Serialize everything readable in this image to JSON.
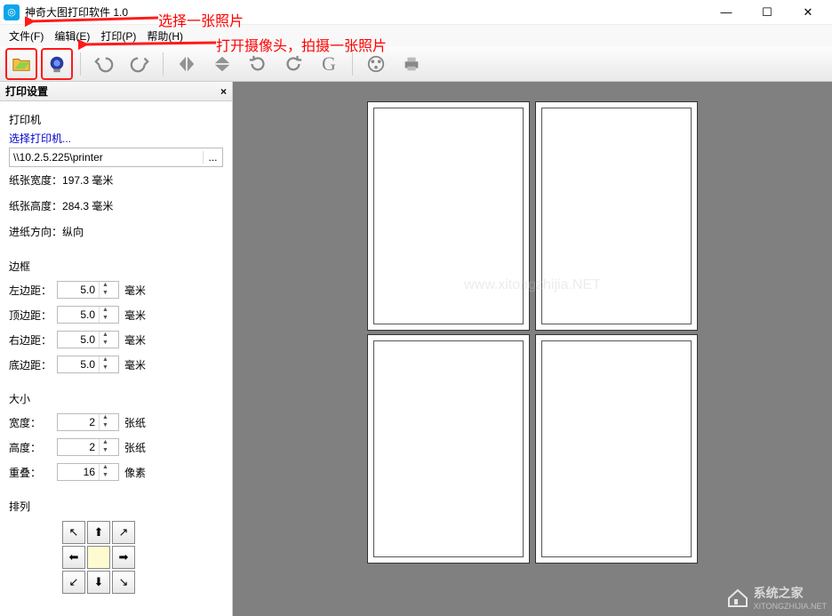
{
  "titlebar": {
    "title": "神奇大图打印软件 1.0"
  },
  "menu": {
    "file": "文件(F)",
    "edit": "编辑(E)",
    "print": "打印(P)",
    "help": "帮助(H)"
  },
  "annotations": {
    "select_photo": "选择一张照片",
    "open_camera": "打开摄像头，拍摄一张照片"
  },
  "panel": {
    "title": "打印设置",
    "printer_section": "打印机",
    "select_printer": "选择打印机...",
    "printer_path": "\\\\10.2.5.225\\printer",
    "paper_width_label": "纸张宽度：",
    "paper_width_value": "197.3 毫米",
    "paper_height_label": "纸张高度：",
    "paper_height_value": "284.3 毫米",
    "feed_label": "进纸方向：",
    "feed_value": "纵向",
    "border_section": "边框",
    "margin_left_label": "左边距：",
    "margin_top_label": "顶边距：",
    "margin_right_label": "右边距：",
    "margin_bottom_label": "底边距：",
    "margin_value": "5.0",
    "margin_unit": "毫米",
    "size_section": "大小",
    "width_label": "宽度：",
    "width_value": "2",
    "height_label": "高度：",
    "height_value": "2",
    "sheet_unit": "张纸",
    "overlap_label": "重叠：",
    "overlap_value": "16",
    "overlap_unit": "像素",
    "arrange_section": "排列"
  },
  "watermark_center": "www.xitongzhijia.NET",
  "watermark_brand": "系统之家",
  "watermark_url": "XITONGZHIJIA.NET"
}
